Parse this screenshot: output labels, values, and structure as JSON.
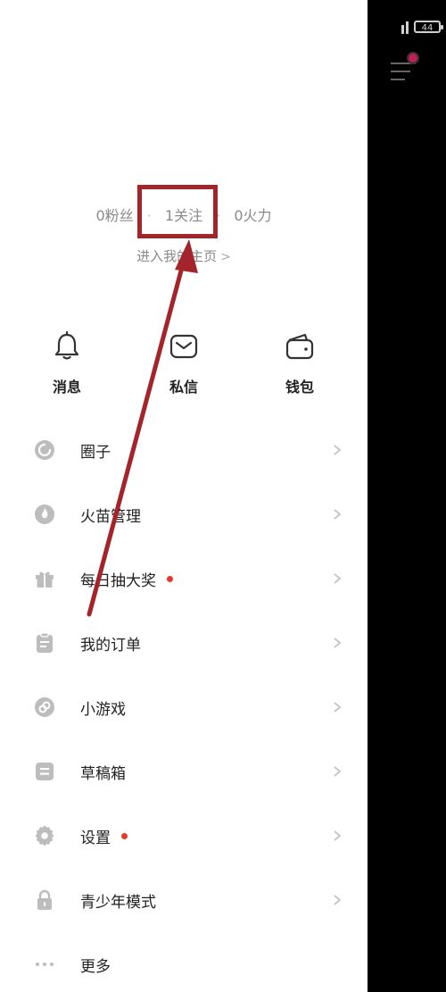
{
  "status": {
    "battery": "44"
  },
  "stats": {
    "fans": "0粉丝",
    "following": "1关注",
    "firepower": "0火力",
    "separator": "·"
  },
  "homepage_link": "进入我的主页",
  "quick_actions": [
    {
      "label": "消息",
      "icon": "bell-icon"
    },
    {
      "label": "私信",
      "icon": "mail-icon"
    },
    {
      "label": "钱包",
      "icon": "wallet-icon"
    }
  ],
  "menu": [
    {
      "label": "圈子",
      "icon": "circle-icon",
      "badge": false
    },
    {
      "label": "火苗管理",
      "icon": "flame-icon",
      "badge": false
    },
    {
      "label": "每日抽大奖",
      "icon": "gift-icon",
      "badge": true
    },
    {
      "label": "我的订单",
      "icon": "clipboard-icon",
      "badge": false
    },
    {
      "label": "小游戏",
      "icon": "game-icon",
      "badge": false
    },
    {
      "label": "草稿箱",
      "icon": "drafts-icon",
      "badge": false
    },
    {
      "label": "设置",
      "icon": "gear-icon",
      "badge": true
    },
    {
      "label": "青少年模式",
      "icon": "lock-icon",
      "badge": false
    },
    {
      "label": "更多",
      "icon": "more-icon",
      "badge": false
    }
  ],
  "colors": {
    "annotation": "#a3242b",
    "badge": "#e23a2e",
    "icon_gray": "#bdbdbd"
  }
}
